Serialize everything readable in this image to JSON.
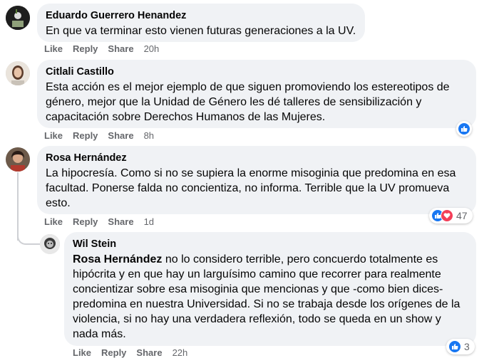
{
  "comments": [
    {
      "author": "Eduardo Guerrero Henandez",
      "text": "En que va terminar esto vienen futuras generaciones a la UV.",
      "like": "Like",
      "reply": "Reply",
      "share": "Share",
      "time": "20h"
    },
    {
      "author": "Citlali Castillo",
      "lines": [
        "Esta acción es el mejor ejemplo de que siguen promoviendo los estereotipos de",
        "género, mejor que la Unidad de Género les dé talleres de sensibilización y",
        "capacitación sobre Derechos Humanos de las Mujeres."
      ],
      "like": "Like",
      "reply": "Reply",
      "share": "Share",
      "time": "8h",
      "reactions": {
        "types": [
          "like"
        ]
      }
    },
    {
      "author": "Rosa Hernández",
      "lines": [
        "La hipocresía. Como si no se supiera la enorme misoginia que predomina en esa",
        "facultad. Ponerse falda no concientiza, no informa. Terrible que la UV promueva",
        "esto."
      ],
      "like": "Like",
      "reply": "Reply",
      "share": "Share",
      "time": "1d",
      "reactions": {
        "types": [
          "like",
          "love"
        ],
        "count": "47"
      }
    },
    {
      "author": "Wil Stein",
      "mention": "Rosa Hernández",
      "first_line_rest": " no lo considero terrible, pero concuerdo totalmente es",
      "lines": [
        "hipócrita y en que hay un larguísimo camino que recorrer para realmente",
        "concientizar sobre esa misoginia que mencionas y que -como bien dices-",
        "predomina en nuestra Universidad. Si no se trabaja desde los orígenes de la",
        "violencia, si no hay una verdadera reflexión, todo se queda en un show y",
        "nada más."
      ],
      "like": "Like",
      "reply": "Reply",
      "share": "Share",
      "time": "22h",
      "reactions": {
        "types": [
          "like"
        ],
        "count": "3"
      }
    }
  ]
}
